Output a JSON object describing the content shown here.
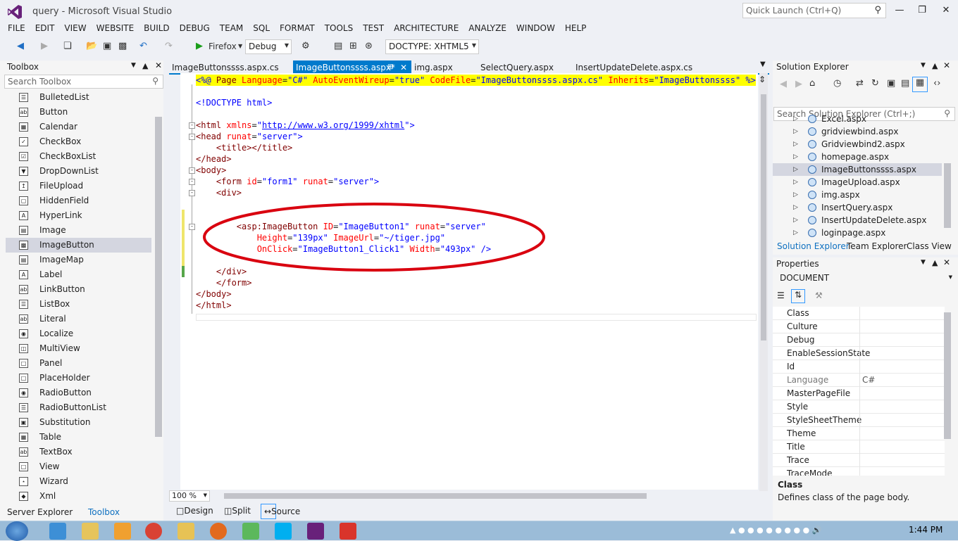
{
  "window": {
    "title": "query - Microsoft Visual Studio",
    "quick_launch": "Quick Launch (Ctrl+Q)"
  },
  "menu": [
    "FILE",
    "EDIT",
    "VIEW",
    "WEBSITE",
    "BUILD",
    "DEBUG",
    "TEAM",
    "SQL",
    "FORMAT",
    "TOOLS",
    "TEST",
    "ARCHITECTURE",
    "ANALYZE",
    "WINDOW",
    "HELP"
  ],
  "toolbar": {
    "browser": "Firefox",
    "config": "Debug",
    "doctype": "DOCTYPE: XHTML5"
  },
  "toolbox": {
    "title": "Toolbox",
    "search": "Search Toolbox",
    "items": [
      "BulletedList",
      "Button",
      "Calendar",
      "CheckBox",
      "CheckBoxList",
      "DropDownList",
      "FileUpload",
      "HiddenField",
      "HyperLink",
      "Image",
      "ImageButton",
      "ImageMap",
      "Label",
      "LinkButton",
      "ListBox",
      "Literal",
      "Localize",
      "MultiView",
      "Panel",
      "PlaceHolder",
      "RadioButton",
      "RadioButtonList",
      "Substitution",
      "Table",
      "TextBox",
      "View",
      "Wizard",
      "Xml"
    ],
    "selected_index": 10,
    "bottom_tabs": [
      "Server Explorer",
      "Toolbox"
    ]
  },
  "editor": {
    "tabs": [
      "ImageButtonssss.aspx.cs",
      "ImageButtonssss.aspx*",
      "img.aspx",
      "SelectQuery.aspx",
      "InsertUpdateDelete.aspx.cs"
    ],
    "active_tab": 1,
    "zoom": "100 %",
    "view_tabs": [
      "Design",
      "Split",
      "Source"
    ],
    "code": {
      "page_directive": {
        "open": "<%@",
        "kw": " Page ",
        "a1": "Language",
        "v1": "\"C#\"",
        "a2": "AutoEventWireup",
        "v2": "\"true\"",
        "a3": "CodeFile",
        "v3": "\"ImageButtonssss.aspx.cs\"",
        "a4": "Inherits",
        "v4": "\"ImageButtonssss\"",
        "close": "%>"
      },
      "doctype": "<!DOCTYPE html>",
      "html_open": "<html",
      "xmlns_attr": " xmlns",
      "xmlns_val": "http://www.w3.org/1999/xhtml",
      "head": "<head",
      "runat": " runat",
      "server": "\"server\"",
      "title": "<title></title>",
      "head_close": "</head>",
      "body": "<body>",
      "form": "<form",
      "id_attr": " id",
      "form_id": "\"form1\"",
      "div": "<div>",
      "imgbtn": "<asp:ImageButton",
      "imgbtn_id": "\"ImageButton1\"",
      "height_attr": "Height",
      "height_val": "\"139px\"",
      "url_attr": " ImageUrl",
      "url_val": "\"~/tiger.jpg\"",
      "onclick_attr": "OnClick",
      "onclick_val": "\"ImageButton1_Click1\"",
      "width_attr": " Width",
      "width_val": "\"493px\"",
      "selfclose": " />",
      "div_close": "</div>",
      "form_close": "</form>",
      "body_close": "</body>",
      "html_close": "</html>"
    }
  },
  "solution_explorer": {
    "title": "Solution Explorer",
    "search": "Search Solution Explorer (Ctrl+;)",
    "items": [
      "Excel.aspx",
      "gridviewbind.aspx",
      "Gridviewbind2.aspx",
      "homepage.aspx",
      "ImageButtonssss.aspx",
      "ImageUpload.aspx",
      "img.aspx",
      "InsertQuery.aspx",
      "InsertUpdateDelete.aspx",
      "loginpage.aspx"
    ],
    "selected_index": 4,
    "tabs": [
      "Solution Explorer",
      "Team Explorer",
      "Class View"
    ]
  },
  "properties": {
    "title": "Properties",
    "object": "DOCUMENT",
    "rows": [
      [
        "Class",
        ""
      ],
      [
        "Culture",
        ""
      ],
      [
        "Debug",
        ""
      ],
      [
        "EnableSessionState",
        ""
      ],
      [
        "Id",
        ""
      ],
      [
        "Language",
        "C#"
      ],
      [
        "MasterPageFile",
        ""
      ],
      [
        "Style",
        ""
      ],
      [
        "StyleSheetTheme",
        ""
      ],
      [
        "Theme",
        ""
      ],
      [
        "Title",
        ""
      ],
      [
        "Trace",
        ""
      ],
      [
        "TraceMode",
        ""
      ]
    ],
    "desc_title": "Class",
    "desc_text": "Defines class of the page body."
  },
  "taskbar": {
    "time": "1:44 PM"
  },
  "colors": {
    "accent": "#007acc",
    "annotation": "#d9000f"
  }
}
